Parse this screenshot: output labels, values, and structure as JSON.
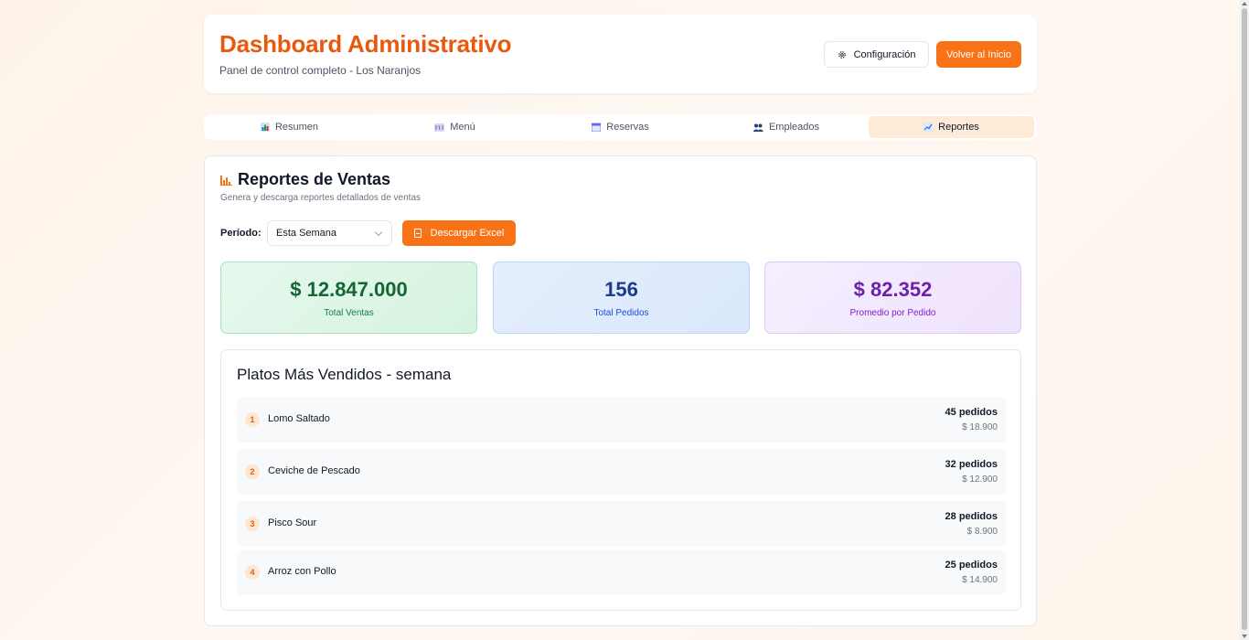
{
  "header": {
    "title": "Dashboard Administrativo",
    "subtitle": "Panel de control completo - Los Naranjos",
    "config_label": "Configuración",
    "home_label": "Volver al Inicio"
  },
  "tabs": [
    {
      "label": "Resumen",
      "icon": "bar-chart-icon",
      "active": false
    },
    {
      "label": "Menú",
      "icon": "menu-icon",
      "active": false
    },
    {
      "label": "Reservas",
      "icon": "calendar-icon",
      "active": false
    },
    {
      "label": "Empleados",
      "icon": "people-icon",
      "active": false
    },
    {
      "label": "Reportes",
      "icon": "trend-chart-icon",
      "active": true
    }
  ],
  "reports": {
    "title": "Reportes de Ventas",
    "description": "Genera y descarga reportes detallados de ventas",
    "period_label": "Período:",
    "period_value": "Esta Semana",
    "download_label": "Descargar Excel"
  },
  "stats": [
    {
      "value": "$ 12.847.000",
      "label": "Total Ventas",
      "color": "#166534"
    },
    {
      "value": "156",
      "label": "Total Pedidos",
      "color": "#1e3a8a"
    },
    {
      "value": "$ 82.352",
      "label": "Promedio por Pedido",
      "color": "#6b21a8"
    }
  ],
  "top_dishes": {
    "title": "Platos Más Vendidos - semana",
    "items": [
      {
        "rank": "1",
        "name": "Lomo Saltado",
        "orders": "45 pedidos",
        "amount": "$ 18.900"
      },
      {
        "rank": "2",
        "name": "Ceviche de Pescado",
        "orders": "32 pedidos",
        "amount": "$ 12.900"
      },
      {
        "rank": "3",
        "name": "Pisco Sour",
        "orders": "28 pedidos",
        "amount": "$ 8.900"
      },
      {
        "rank": "4",
        "name": "Arroz con Pollo",
        "orders": "25 pedidos",
        "amount": "$ 14.900"
      }
    ]
  },
  "colors": {
    "accent": "#f97316",
    "title": "#ea580c"
  }
}
